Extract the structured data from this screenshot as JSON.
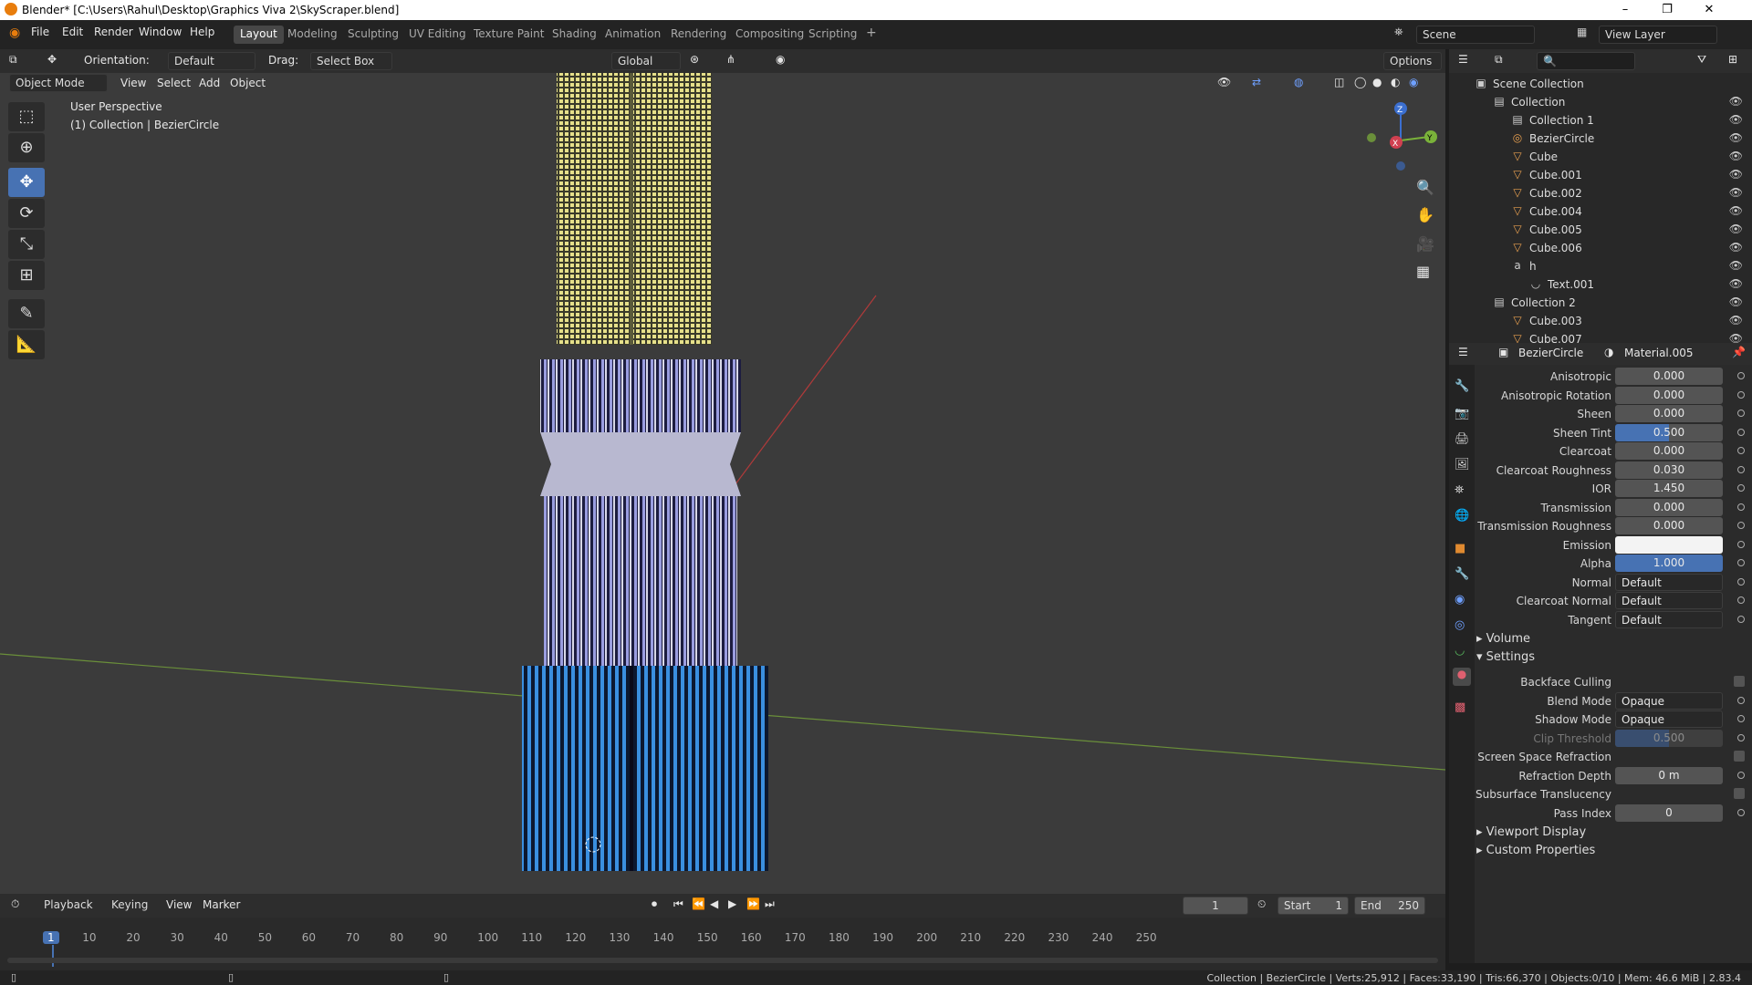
{
  "window": {
    "title": "Blender* [C:\\Users\\Rahul\\Desktop\\Graphics Viva 2\\SkyScraper.blend]",
    "minimize": "–",
    "restore": "❐",
    "close": "✕"
  },
  "menu": [
    "File",
    "Edit",
    "Render",
    "Window",
    "Help"
  ],
  "workspaces": [
    "Layout",
    "Modeling",
    "Sculpting",
    "UV Editing",
    "Texture Paint",
    "Shading",
    "Animation",
    "Rendering",
    "Compositing",
    "Scripting",
    "+"
  ],
  "scene": {
    "label": "Scene",
    "view_layer": "View Layer"
  },
  "header": {
    "orientation_label": "Orientation:",
    "orientation_value": "Default",
    "drag_label": "Drag:",
    "drag_value": "Select Box",
    "transform": "Global",
    "options": "Options"
  },
  "viewport_header": {
    "mode": "Object Mode",
    "view": "View",
    "select": "Select",
    "add": "Add",
    "object": "Object"
  },
  "viewport": {
    "perspective": "User Perspective",
    "collection_info": "(1) Collection | BezierCircle",
    "gizmo": {
      "z": "Z",
      "y": "Y",
      "x": "X"
    }
  },
  "outliner": {
    "search_placeholder": "",
    "rows": [
      {
        "label": "Scene Collection",
        "indent": 0,
        "icon": "scene-collection-icon",
        "glyph": "▣"
      },
      {
        "label": "Collection",
        "indent": 1,
        "icon": "collection-icon",
        "glyph": "▤"
      },
      {
        "label": "Collection 1",
        "indent": 2,
        "icon": "collection-icon",
        "glyph": "▤"
      },
      {
        "label": "BezierCircle",
        "indent": 2,
        "icon": "curve-icon",
        "glyph": "◎"
      },
      {
        "label": "Cube",
        "indent": 2,
        "icon": "mesh-icon",
        "glyph": "▽"
      },
      {
        "label": "Cube.001",
        "indent": 2,
        "icon": "mesh-icon",
        "glyph": "▽"
      },
      {
        "label": "Cube.002",
        "indent": 2,
        "icon": "mesh-icon",
        "glyph": "▽"
      },
      {
        "label": "Cube.004",
        "indent": 2,
        "icon": "mesh-icon",
        "glyph": "▽"
      },
      {
        "label": "Cube.005",
        "indent": 2,
        "icon": "mesh-icon",
        "glyph": "▽"
      },
      {
        "label": "Cube.006",
        "indent": 2,
        "icon": "mesh-icon",
        "glyph": "▽"
      },
      {
        "label": "h",
        "indent": 2,
        "icon": "text-object-icon",
        "glyph": "a"
      },
      {
        "label": "Text.001",
        "indent": 3,
        "icon": "text-data-icon",
        "glyph": "◡"
      },
      {
        "label": "Collection 2",
        "indent": 1,
        "icon": "collection-icon",
        "glyph": "▤"
      },
      {
        "label": "Cube.003",
        "indent": 2,
        "icon": "mesh-icon",
        "glyph": "▽"
      },
      {
        "label": "Cube.007",
        "indent": 2,
        "icon": "mesh-icon",
        "glyph": "▽"
      }
    ]
  },
  "properties": {
    "object": "BezierCircle",
    "material": "Material.005",
    "rows": [
      {
        "label": "Anisotropic",
        "value": "0.000",
        "style": "plain"
      },
      {
        "label": "Anisotropic Rotation",
        "value": "0.000",
        "style": "plain"
      },
      {
        "label": "Sheen",
        "value": "0.000",
        "style": "plain"
      },
      {
        "label": "Sheen Tint",
        "value": "0.500",
        "style": "half"
      },
      {
        "label": "Clearcoat",
        "value": "0.000",
        "style": "plain"
      },
      {
        "label": "Clearcoat Roughness",
        "value": "0.030",
        "style": "plain"
      },
      {
        "label": "IOR",
        "value": "1.450",
        "style": "plain"
      },
      {
        "label": "Transmission",
        "value": "0.000",
        "style": "plain"
      },
      {
        "label": "Transmission Roughness",
        "value": "0.000",
        "style": "plain"
      },
      {
        "label": "Emission",
        "value": "",
        "style": "white"
      },
      {
        "label": "Alpha",
        "value": "1.000",
        "style": "blue"
      },
      {
        "label": "Normal",
        "value": "Default",
        "style": "drop"
      },
      {
        "label": "Clearcoat Normal",
        "value": "Default",
        "style": "drop"
      },
      {
        "label": "Tangent",
        "value": "Default",
        "style": "drop"
      }
    ],
    "volume": "Volume",
    "settings": "Settings",
    "settings_rows": [
      {
        "label": "Backface Culling",
        "value": "",
        "style": "check"
      },
      {
        "label": "Blend Mode",
        "value": "Opaque",
        "style": "drop"
      },
      {
        "label": "Shadow Mode",
        "value": "Opaque",
        "style": "drop"
      },
      {
        "label": "Clip Threshold",
        "value": "0.500",
        "style": "dim"
      },
      {
        "label": "Screen Space Refraction",
        "value": "",
        "style": "check"
      },
      {
        "label": "Refraction Depth",
        "value": "0 m",
        "style": "plain"
      },
      {
        "label": "Subsurface Translucency",
        "value": "",
        "style": "check"
      },
      {
        "label": "Pass Index",
        "value": "0",
        "style": "plain"
      }
    ],
    "viewport_display": "Viewport Display",
    "custom_properties": "Custom Properties"
  },
  "timeline": {
    "playback": "Playback",
    "keying": "Keying",
    "view": "View",
    "marker": "Marker",
    "current_frame": "1",
    "start_label": "Start",
    "start": "1",
    "end_label": "End",
    "end": "250",
    "ticks": [
      "1",
      "10",
      "20",
      "30",
      "40",
      "50",
      "60",
      "70",
      "80",
      "90",
      "100",
      "110",
      "120",
      "130",
      "140",
      "150",
      "160",
      "170",
      "180",
      "190",
      "200",
      "210",
      "220",
      "230",
      "240",
      "250"
    ]
  },
  "status": {
    "text": "Collection | BezierCircle | Verts:25,912 | Faces:33,190 | Tris:66,370 | Objects:0/10 | Mem: 46.6 MiB | 2.83.4"
  },
  "colors": {
    "accent": "#4772b3",
    "viewport_bg": "#3b3b3b",
    "tower_top": "#e6e08a",
    "tower_mid": "#9a9de0",
    "tower_base": "#3a8fe0"
  }
}
